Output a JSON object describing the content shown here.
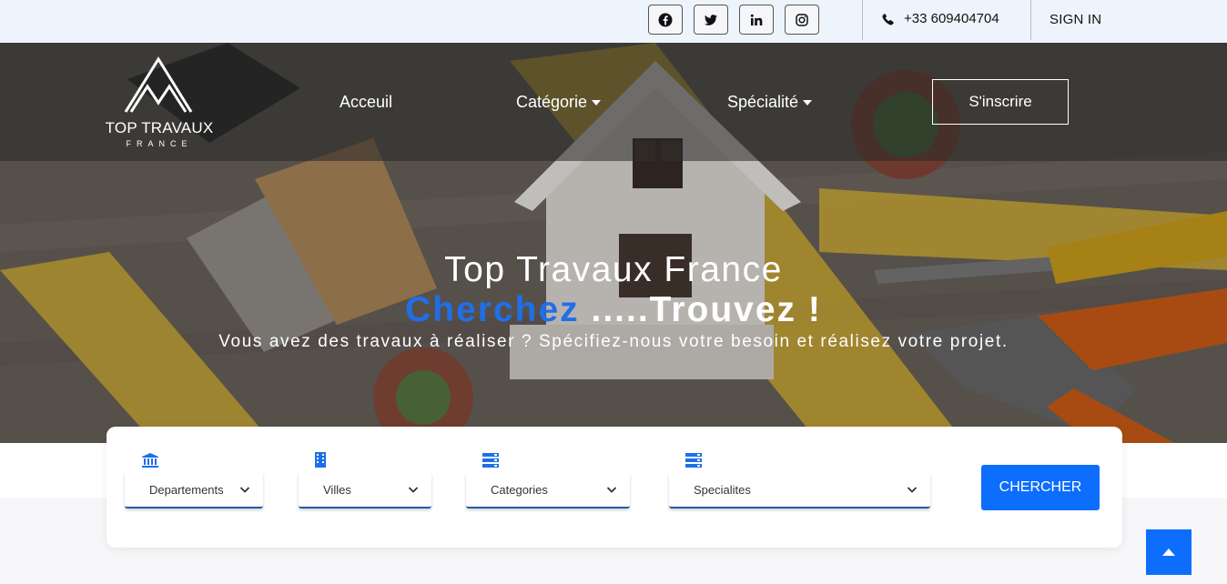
{
  "topbar": {
    "social_icons": [
      "facebook-icon",
      "twitter-icon",
      "linkedin-icon",
      "instagram-icon"
    ],
    "phone": "+33 609404704",
    "signin": "SIGN IN"
  },
  "logo": {
    "brand": "TOP TRAVAUX",
    "sub": "FRANCE"
  },
  "nav": {
    "items": [
      {
        "label": "Acceuil"
      },
      {
        "label": "Catégorie"
      },
      {
        "label": "Spécialité"
      }
    ],
    "cta": "S'inscrire"
  },
  "hero": {
    "title": "Top Travaux France",
    "tagline_blue": "Cherchez",
    "tagline_rest": " .....Trouvez !",
    "subtitle": "Vous avez des travaux à réaliser ? Spécifiez-nous votre besoin et réalisez votre projet."
  },
  "search": {
    "filters": [
      {
        "label": "Departements",
        "icon": "bank-icon"
      },
      {
        "label": "Villes",
        "icon": "building-icon"
      },
      {
        "label": "Categories",
        "icon": "server-icon"
      },
      {
        "label": "Specialites",
        "icon": "server-icon"
      }
    ],
    "button": "CHERCHER"
  },
  "colors": {
    "accent": "#0d6efd",
    "topbar_bg": "#eef4fc"
  }
}
